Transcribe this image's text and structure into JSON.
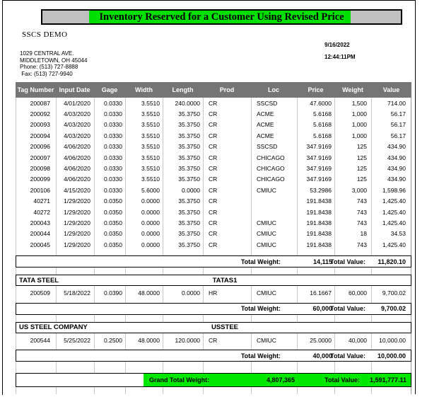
{
  "report": {
    "title": "Inventory Reserved for a Customer Using Revised Price",
    "demo_name": "SSCS DEMO",
    "address": "1029 CENTRAL AVE.\nMIDDLETOWN, OH 45044\nPhone: (513) 727-8888\n Fax: (513) 727-9940",
    "date": "9/16/2022",
    "time": "12:44:11PM",
    "stamp": "9/16/2022\n12:44:11PM"
  },
  "colors": {
    "title_band": "#c0c0c0",
    "title_highlight": "#00e000",
    "header_row": "#757575",
    "grand_total_highlight": "#00e800"
  },
  "table": {
    "columns": [
      "Tag Number",
      "Input Date",
      "Gage",
      "Width",
      "Length",
      "Prod",
      "Loc",
      "Price",
      "Weight",
      "Value"
    ],
    "rows": [
      {
        "tag": "200087",
        "date": "4/01/2020",
        "gage": "0.0330",
        "width": "3.5510",
        "length": "240.0000",
        "prod": "CR",
        "loc": "SSCSD",
        "price": "47.6000",
        "weight": "1,500",
        "value": "714.00"
      },
      {
        "tag": "200092",
        "date": "4/03/2020",
        "gage": "0.0330",
        "width": "3.5510",
        "length": "35.3750",
        "prod": "CR",
        "loc": "ACME",
        "price": "5.6168",
        "weight": "1,000",
        "value": "56.17"
      },
      {
        "tag": "200093",
        "date": "4/03/2020",
        "gage": "0.0330",
        "width": "3.5510",
        "length": "35.3750",
        "prod": "CR",
        "loc": "ACME",
        "price": "5.6168",
        "weight": "1,000",
        "value": "56.17"
      },
      {
        "tag": "200094",
        "date": "4/03/2020",
        "gage": "0.0330",
        "width": "3.5510",
        "length": "35.3750",
        "prod": "CR",
        "loc": "ACME",
        "price": "5.6168",
        "weight": "1,000",
        "value": "56.17"
      },
      {
        "tag": "200096",
        "date": "4/06/2020",
        "gage": "0.0330",
        "width": "3.5510",
        "length": "35.3750",
        "prod": "CR",
        "loc": "SSCSD",
        "price": "347.9169",
        "weight": "125",
        "value": "434.90"
      },
      {
        "tag": "200097",
        "date": "4/06/2020",
        "gage": "0.0330",
        "width": "3.5510",
        "length": "35.3750",
        "prod": "CR",
        "loc": "CHICAGO",
        "price": "347.9169",
        "weight": "125",
        "value": "434.90"
      },
      {
        "tag": "200098",
        "date": "4/06/2020",
        "gage": "0.0330",
        "width": "3.5510",
        "length": "35.3750",
        "prod": "CR",
        "loc": "CHICAGO",
        "price": "347.9169",
        "weight": "125",
        "value": "434.90"
      },
      {
        "tag": "200099",
        "date": "4/06/2020",
        "gage": "0.0330",
        "width": "3.5510",
        "length": "35.3750",
        "prod": "CR",
        "loc": "CHICAGO",
        "price": "347.9169",
        "weight": "125",
        "value": "434.90"
      },
      {
        "tag": "200106",
        "date": "4/15/2020",
        "gage": "0.0330",
        "width": "5.6000",
        "length": "0.0000",
        "prod": "CR",
        "loc": "CMIUC",
        "price": "53.2986",
        "weight": "3,000",
        "value": "1,598.96"
      },
      {
        "tag": "40271",
        "date": "1/29/2020",
        "gage": "0.0350",
        "width": "0.0000",
        "length": "35.3750",
        "prod": "CR",
        "loc": "",
        "price": "191.8438",
        "weight": "743",
        "value": "1,425.40"
      },
      {
        "tag": "40272",
        "date": "1/29/2020",
        "gage": "0.0350",
        "width": "0.0000",
        "length": "35.3750",
        "prod": "CR",
        "loc": "",
        "price": "191.8438",
        "weight": "743",
        "value": "1,425.40"
      },
      {
        "tag": "200043",
        "date": "1/29/2020",
        "gage": "0.0350",
        "width": "0.0000",
        "length": "35.3750",
        "prod": "CR",
        "loc": "CMIUC",
        "price": "191.8438",
        "weight": "743",
        "value": "1,425.40"
      },
      {
        "tag": "200044",
        "date": "1/29/2020",
        "gage": "0.0350",
        "width": "0.0000",
        "length": "35.3750",
        "prod": "CR",
        "loc": "CMIUC",
        "price": "191.8438",
        "weight": "18",
        "value": "34.53"
      },
      {
        "tag": "200045",
        "date": "1/29/2020",
        "gage": "0.0350",
        "width": "0.0000",
        "length": "35.3750",
        "prod": "CR",
        "loc": "CMIUC",
        "price": "191.8438",
        "weight": "743",
        "value": "1,425.40"
      }
    ]
  },
  "subtotal_1": {
    "weight_label": "Total Weight:",
    "weight_value": "14,115",
    "value_label": "Total Value:",
    "value_value": "11,820.10"
  },
  "sections": [
    {
      "name": "TATA STEEL",
      "code": "TATAS1",
      "rows": [
        {
          "tag": "200509",
          "date": "5/18/2022",
          "gage": "0.0390",
          "width": "48.0000",
          "length": "0.0000",
          "prod": "HR",
          "loc": "CMIUC",
          "price": "16.1667",
          "weight": "60,000",
          "value": "9,700.02"
        }
      ],
      "subtotal": {
        "weight_label": "Total Weight:",
        "weight_value": "60,000",
        "value_label": "Total Value:",
        "value_value": "9,700.02"
      }
    },
    {
      "name": "US STEEL COMPANY",
      "code": "USSTEE",
      "rows": [
        {
          "tag": "200544",
          "date": "5/25/2022",
          "gage": "0.2500",
          "width": "48.0000",
          "length": "120.0000",
          "prod": "CR",
          "loc": "CMIUC",
          "price": "25.0000",
          "weight": "40,000",
          "value": "10,000.00"
        }
      ],
      "subtotal": {
        "weight_label": "Total Weight:",
        "weight_value": "40,000",
        "value_label": "Total Value:",
        "value_value": "10,000.00"
      }
    }
  ],
  "grand_total": {
    "weight_label": "Grand Total Weight:",
    "weight_value": "4,807,365",
    "value_label": "Total Value:",
    "value_value": "1,591,777.11"
  }
}
